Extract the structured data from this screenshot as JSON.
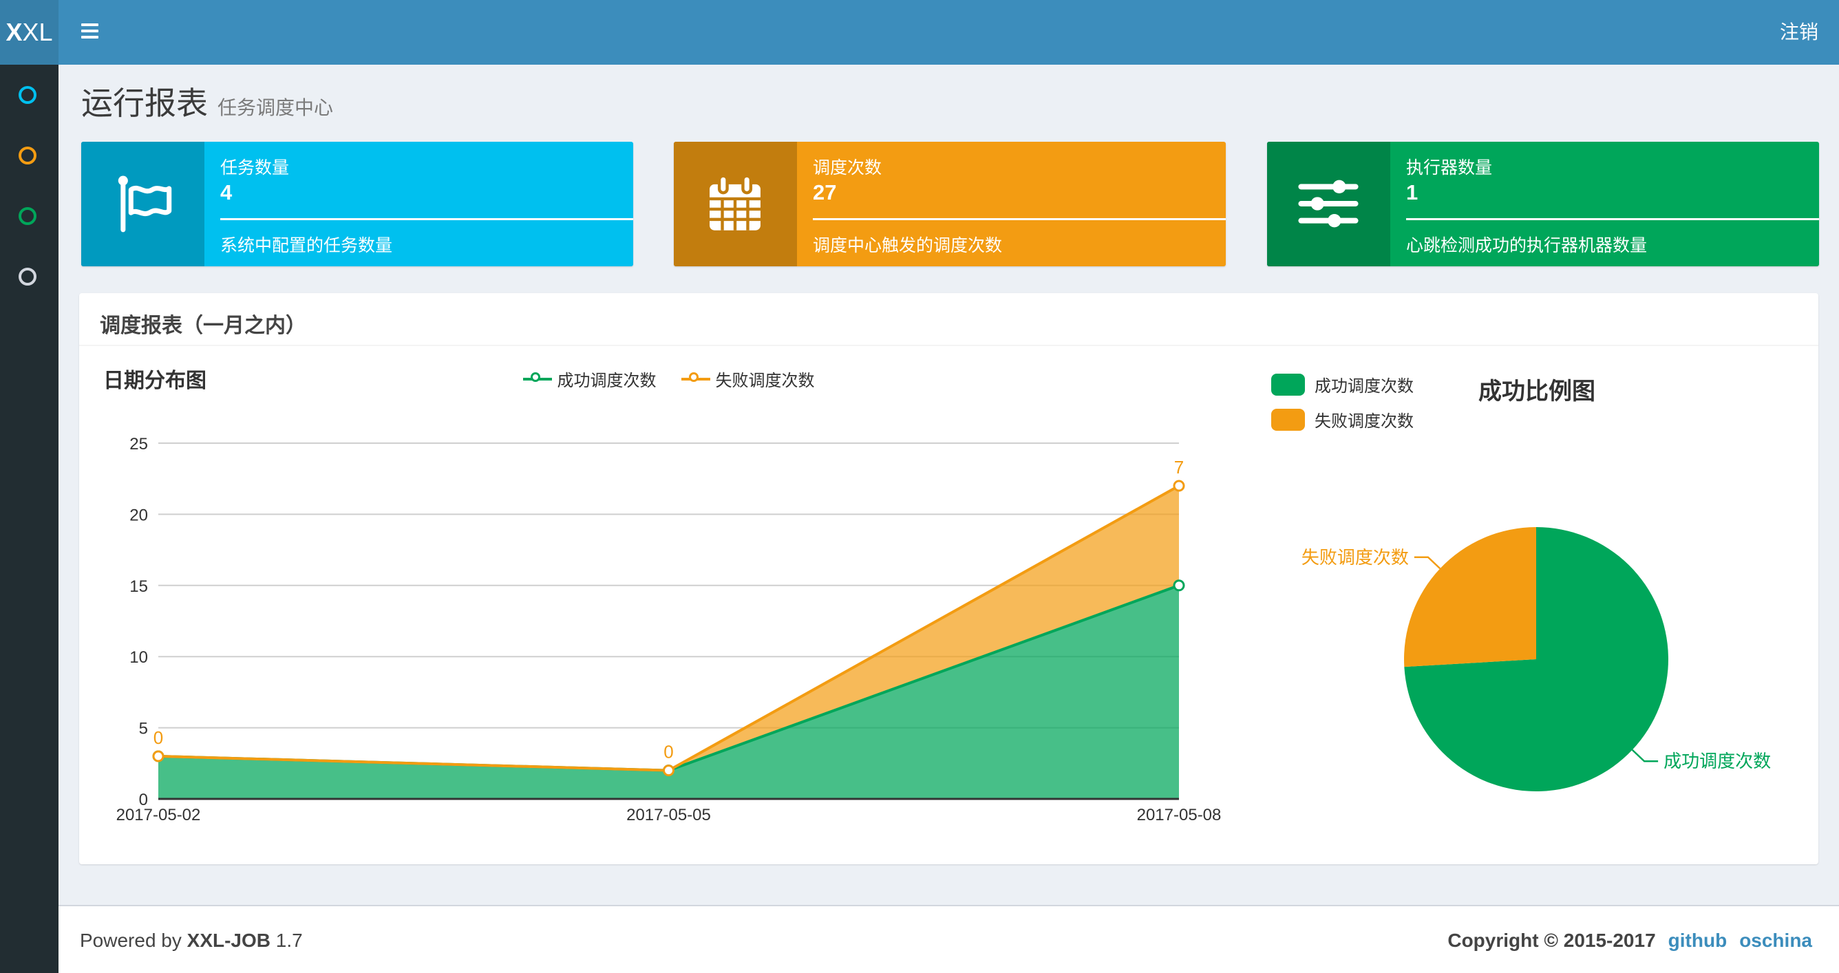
{
  "navbar": {
    "logo_bold": "X",
    "logo_rest": "XL",
    "logout": "注销"
  },
  "sidebar": {
    "items": [
      {
        "icon": "circle-o",
        "color": "#00c0ef"
      },
      {
        "icon": "circle-o",
        "color": "#f39c12"
      },
      {
        "icon": "circle-o",
        "color": "#00a65a"
      },
      {
        "icon": "circle-o",
        "color": "#d2d6de"
      }
    ]
  },
  "page": {
    "title": "运行报表",
    "subtitle": "任务调度中心"
  },
  "stats": [
    {
      "label": "任务数量",
      "value": "4",
      "desc": "系统中配置的任务数量",
      "color": "#00c0ef",
      "icon_bg": "#009abf",
      "icon": "flag"
    },
    {
      "label": "调度次数",
      "value": "27",
      "desc": "调度中心触发的调度次数",
      "color": "#f39c12",
      "icon_bg": "#c27d0e",
      "icon": "calendar"
    },
    {
      "label": "执行器数量",
      "value": "1",
      "desc": "心跳检测成功的执行器机器数量",
      "color": "#00a65a",
      "icon_bg": "#008548",
      "icon": "sliders"
    }
  ],
  "panel": {
    "title": "调度报表（一月之内）"
  },
  "chart_data": [
    {
      "type": "area",
      "title": "日期分布图",
      "categories": [
        "2017-05-02",
        "2017-05-05",
        "2017-05-08"
      ],
      "series": [
        {
          "name": "成功调度次数",
          "values": [
            3,
            2,
            15
          ],
          "color": "#00a65a",
          "fill": "rgba(0,166,90,0.72)",
          "stacked": false
        },
        {
          "name": "失败调度次数",
          "values": [
            0,
            0,
            7
          ],
          "color": "#f39c12",
          "fill": "rgba(243,156,18,0.70)",
          "stacked": true,
          "point_labels": [
            "0",
            "0",
            "7"
          ]
        }
      ],
      "ylim": [
        0,
        25
      ],
      "yticks": [
        0,
        5,
        10,
        15,
        20,
        25
      ],
      "grid": true,
      "legend_position": "top-center",
      "legend": [
        {
          "label": "成功调度次数",
          "color": "#00a65a"
        },
        {
          "label": "失败调度次数",
          "color": "#f39c12"
        }
      ]
    },
    {
      "type": "pie",
      "title": "成功比例图",
      "slices": [
        {
          "label": "成功调度次数",
          "value": 20,
          "color": "#00a65a"
        },
        {
          "label": "失败调度次数",
          "value": 7,
          "color": "#f39c12"
        }
      ],
      "legend_position": "top-left",
      "legend": [
        {
          "label": "成功调度次数",
          "color": "#00a65a"
        },
        {
          "label": "失败调度次数",
          "color": "#f39c12"
        }
      ]
    }
  ],
  "footer": {
    "powered_prefix": "Powered by",
    "brand": "XXL-JOB",
    "version": "1.7",
    "copyright": "Copyright © 2015-2017",
    "links": [
      {
        "label": "github"
      },
      {
        "label": "oschina"
      }
    ]
  }
}
